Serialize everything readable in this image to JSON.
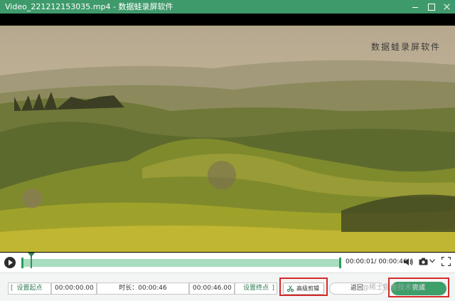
{
  "window": {
    "file_name": "Video_221212153035.mp4",
    "separator": " - ",
    "app_name": "数据蛙录屏软件",
    "icons": [
      "app-icon",
      "minimize-icon",
      "maximize-icon",
      "close-icon"
    ]
  },
  "video": {
    "watermark": "数据蛙录屏软件"
  },
  "player": {
    "current_time": "00:00:01",
    "total_time": "00:00:46",
    "time_separator": "/ ",
    "playhead_fraction": 0.025,
    "icons": [
      "play-icon",
      "volume-icon",
      "camera-icon",
      "chevron-down-icon",
      "fullscreen-icon"
    ],
    "colors": {
      "track": "#a8ddbf",
      "handle": "#2a9d5c"
    }
  },
  "trim": {
    "set_start_label": "设置起点",
    "start_value": "00:00:00.00",
    "duration_label": "时长：",
    "duration_value": "00:00:46",
    "end_value": "00:00:46.00",
    "set_end_label": "设置终点",
    "advanced_label": "高级剪辑"
  },
  "actions": {
    "back_label": "返回",
    "finish_label": "完成",
    "accent": "#3d9f6a"
  },
  "overlay": {
    "community_watermark": "@稀土掘金技术社区",
    "highlight_color": "#d62a2a"
  }
}
